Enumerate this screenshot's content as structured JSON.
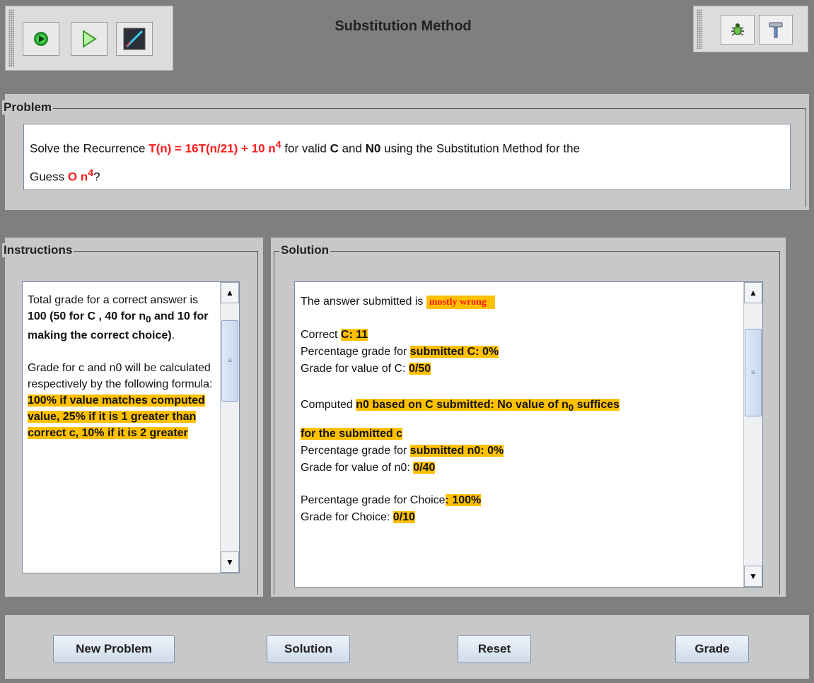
{
  "title": "Substitution Method",
  "icons": {
    "run": "run-icon",
    "play": "play-icon",
    "chart": "chart-icon",
    "debug": "bug-icon",
    "tools": "hammer-icon"
  },
  "problem": {
    "legend": "Problem",
    "text_1": "Solve the Recurrence ",
    "recurrence": "T(n) = 16T(n/21) + 10 n",
    "sup_1": "4",
    "text_2": " for valid ",
    "c_label": "C",
    "text_3": " and ",
    "n0_label": "N0",
    "text_4": " using the Substitution Method for the",
    "text_5": "Guess ",
    "guess": "O n",
    "sup_2": "4",
    "text_6": "?"
  },
  "instructions": {
    "legend": "Instructions",
    "p1_a": "Total grade for a correct answer is ",
    "p1_b": "100 (50 for C , 40 for n",
    "p1_sub": "0",
    "p1_c": " and 10 for making the correct choice)",
    "p1_d": ".",
    "p2_a": "Grade for c and n0 will be calculated respectively by the following formula:",
    "p2_b": "100% if value matches computed value, 25% if it is 1 greater than correct c, 10% if it is 2 greater"
  },
  "solution": {
    "legend": "Solution",
    "line1_a": "The answer submitted is ",
    "verdict": "mostly wrong",
    "correct_label": "Correct ",
    "correct_value": "C: 11",
    "pct_c_label": "Percentage grade for ",
    "pct_c_value": "submitted C: 0%",
    "grade_c_label": "Grade for value of C: ",
    "grade_c_value": "0/50",
    "computed_label": "Computed ",
    "computed_value_a": "n0 based on C submitted: No value of n",
    "computed_sub": "0",
    "computed_value_b": " suffices",
    "computed_value_c": "for the submitted c",
    "pct_n0_label": "Percentage grade for ",
    "pct_n0_value": "submitted n0: 0%",
    "grade_n0_label": "Grade for value of n0: ",
    "grade_n0_value": "0/40",
    "pct_choice_label": "Percentage grade for Choice",
    "pct_choice_value": ": 100%",
    "grade_choice_label": "Grade for Choice: ",
    "grade_choice_value": "0/10"
  },
  "buttons": {
    "new_problem": "New Problem",
    "solution": "Solution",
    "reset": "Reset",
    "grade": "Grade"
  },
  "colors": {
    "highlight": "#ffc000",
    "accent_red": "#ff1a1a",
    "background": "#7f7f7f",
    "panel": "#c8c8c8"
  }
}
